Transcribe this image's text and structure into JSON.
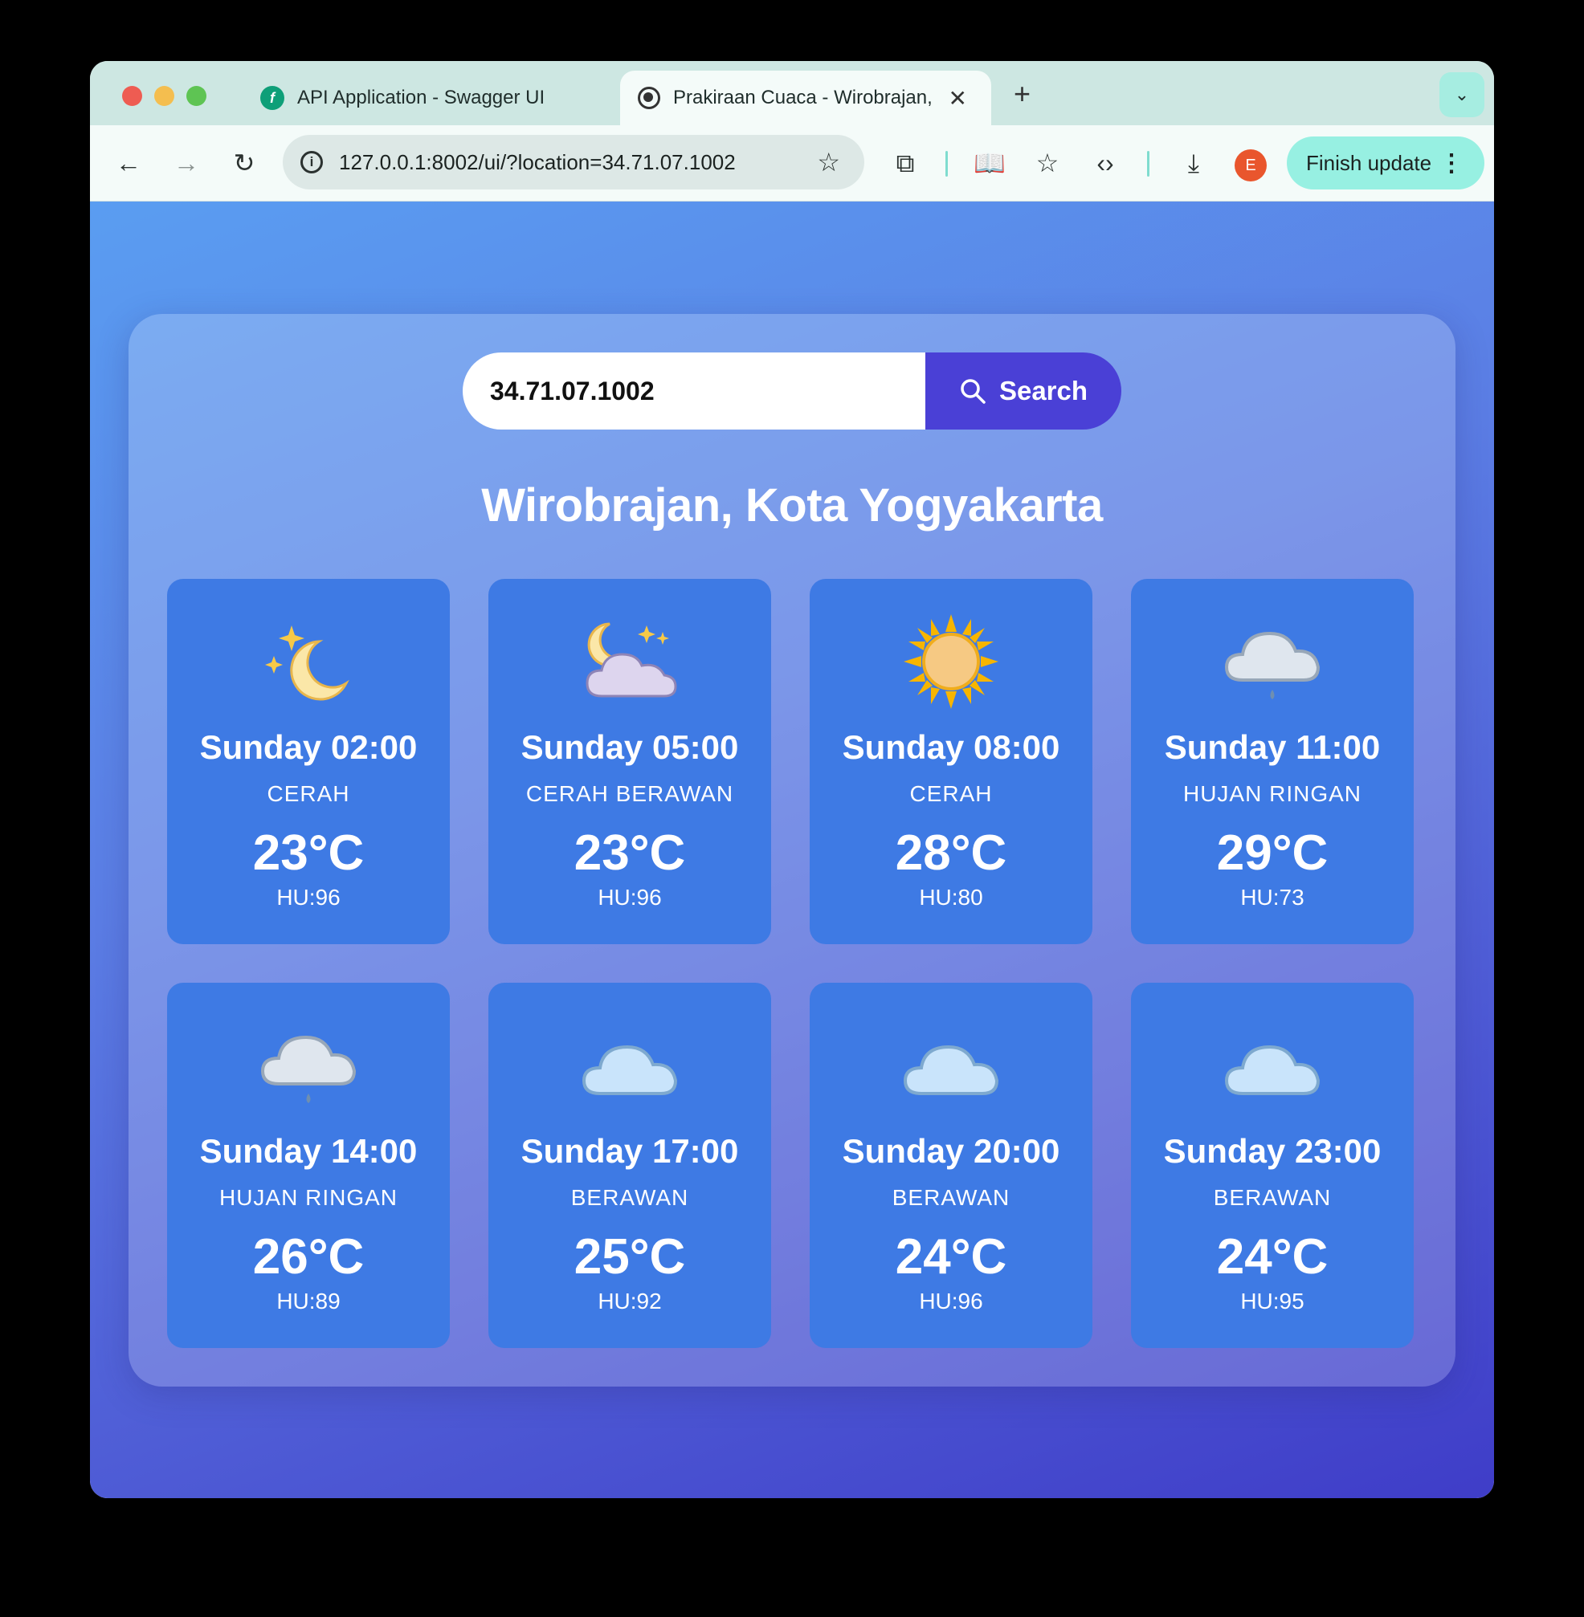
{
  "browser": {
    "tabs": [
      {
        "title": "API Application - Swagger UI",
        "icon": "swagger-icon"
      },
      {
        "title": "Prakiraan Cuaca - Wirobrajan, Kota Yogyakarta",
        "icon": "globe-icon"
      }
    ],
    "url": "127.0.0.1:8002/ui/?location=34.71.07.1002",
    "avatar_letter": "E",
    "finish_update_label": "Finish update"
  },
  "search": {
    "value": "34.71.07.1002",
    "button_label": "Search"
  },
  "location_title": "Wirobrajan, Kota Yogyakarta",
  "forecasts": [
    {
      "time": "Sunday 02:00",
      "condition": "CERAH",
      "temp": "23°C",
      "humidity": "HU:96",
      "icon": "crescent-moon-stars-icon"
    },
    {
      "time": "Sunday 05:00",
      "condition": "CERAH BERAWAN",
      "temp": "23°C",
      "humidity": "HU:96",
      "icon": "moon-cloud-icon"
    },
    {
      "time": "Sunday 08:00",
      "condition": "CERAH",
      "temp": "28°C",
      "humidity": "HU:80",
      "icon": "sun-icon"
    },
    {
      "time": "Sunday 11:00",
      "condition": "HUJAN RINGAN",
      "temp": "29°C",
      "humidity": "HU:73",
      "icon": "rain-cloud-icon"
    },
    {
      "time": "Sunday 14:00",
      "condition": "HUJAN RINGAN",
      "temp": "26°C",
      "humidity": "HU:89",
      "icon": "rain-cloud-icon"
    },
    {
      "time": "Sunday 17:00",
      "condition": "BERAWAN",
      "temp": "25°C",
      "humidity": "HU:92",
      "icon": "cloud-icon"
    },
    {
      "time": "Sunday 20:00",
      "condition": "BERAWAN",
      "temp": "24°C",
      "humidity": "HU:96",
      "icon": "cloud-icon"
    },
    {
      "time": "Sunday 23:00",
      "condition": "BERAWAN",
      "temp": "24°C",
      "humidity": "HU:95",
      "icon": "cloud-icon"
    }
  ]
}
